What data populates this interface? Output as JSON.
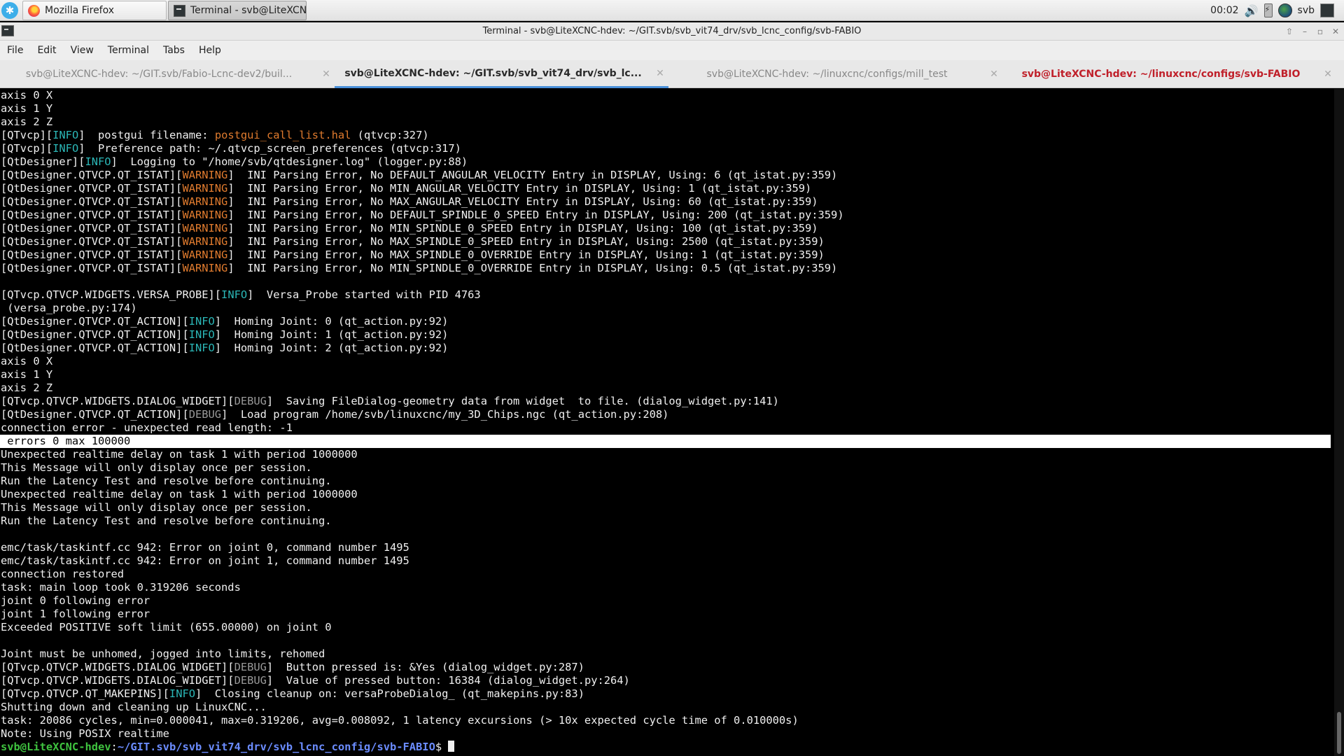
{
  "taskbar": {
    "menu_icon": "start-menu-icon",
    "windows": [
      {
        "label": "Mozilla Firefox",
        "icon": "firefox-icon"
      },
      {
        "label": "Terminal - svb@LiteXCN...",
        "icon": "terminal-icon"
      }
    ],
    "clock": "00:02",
    "user": "svb"
  },
  "window": {
    "title": "Terminal - svb@LiteXCNC-hdev: ~/GIT.svb/svb_vit74_drv/svb_lcnc_config/svb-FABIO"
  },
  "menu": [
    "File",
    "Edit",
    "View",
    "Terminal",
    "Tabs",
    "Help"
  ],
  "tabs": [
    {
      "label": "svb@LiteXCNC-hdev: ~/GIT.svb/Fabio-Lcnc-dev2/buil...",
      "state": "inactive"
    },
    {
      "label": "svb@LiteXCNC-hdev: ~/GIT.svb/svb_vit74_drv/svb_lc...",
      "state": "active"
    },
    {
      "label": "svb@LiteXCNC-hdev: ~/linuxcnc/configs/mill_test",
      "state": "inactive"
    },
    {
      "label": "svb@LiteXCNC-hdev: ~/linuxcnc/configs/svb-FABIO",
      "state": "alert"
    }
  ],
  "colors": {
    "info": "#2bb7b7",
    "warning": "#e07b2e",
    "debug": "#999999",
    "prompt_user": "#3fc23f",
    "prompt_path": "#6b8cff",
    "active_tab_underline": "#4a90d9",
    "alert_tab": "#c0202a"
  },
  "terminal": {
    "lines": [
      [
        {
          "t": "axis 0 X"
        }
      ],
      [
        {
          "t": "axis 1 Y"
        }
      ],
      [
        {
          "t": "axis 2 Z"
        }
      ],
      [
        {
          "t": "[QTvcp]["
        },
        {
          "t": "INFO",
          "c": "info"
        },
        {
          "t": "]  postgui filename: "
        },
        {
          "t": "postgui_call_list.hal",
          "c": "file"
        },
        {
          "t": " (qtvcp:327)"
        }
      ],
      [
        {
          "t": "[QTvcp]["
        },
        {
          "t": "INFO",
          "c": "info"
        },
        {
          "t": "]  Preference path: ~/.qtvcp_screen_preferences (qtvcp:317)"
        }
      ],
      [
        {
          "t": "[QtDesigner]["
        },
        {
          "t": "INFO",
          "c": "info"
        },
        {
          "t": "]  Logging to \"/home/svb/qtdesigner.log\" (logger.py:88)"
        }
      ],
      [
        {
          "t": "[QtDesigner.QTVCP.QT_ISTAT]["
        },
        {
          "t": "WARNING",
          "c": "warn"
        },
        {
          "t": "]  INI Parsing Error, No DEFAULT_ANGULAR_VELOCITY Entry in DISPLAY, Using: 6 (qt_istat.py:359)"
        }
      ],
      [
        {
          "t": "[QtDesigner.QTVCP.QT_ISTAT]["
        },
        {
          "t": "WARNING",
          "c": "warn"
        },
        {
          "t": "]  INI Parsing Error, No MIN_ANGULAR_VELOCITY Entry in DISPLAY, Using: 1 (qt_istat.py:359)"
        }
      ],
      [
        {
          "t": "[QtDesigner.QTVCP.QT_ISTAT]["
        },
        {
          "t": "WARNING",
          "c": "warn"
        },
        {
          "t": "]  INI Parsing Error, No MAX_ANGULAR_VELOCITY Entry in DISPLAY, Using: 60 (qt_istat.py:359)"
        }
      ],
      [
        {
          "t": "[QtDesigner.QTVCP.QT_ISTAT]["
        },
        {
          "t": "WARNING",
          "c": "warn"
        },
        {
          "t": "]  INI Parsing Error, No DEFAULT_SPINDLE_0_SPEED Entry in DISPLAY, Using: 200 (qt_istat.py:359)"
        }
      ],
      [
        {
          "t": "[QtDesigner.QTVCP.QT_ISTAT]["
        },
        {
          "t": "WARNING",
          "c": "warn"
        },
        {
          "t": "]  INI Parsing Error, No MIN_SPINDLE_0_SPEED Entry in DISPLAY, Using: 100 (qt_istat.py:359)"
        }
      ],
      [
        {
          "t": "[QtDesigner.QTVCP.QT_ISTAT]["
        },
        {
          "t": "WARNING",
          "c": "warn"
        },
        {
          "t": "]  INI Parsing Error, No MAX_SPINDLE_0_SPEED Entry in DISPLAY, Using: 2500 (qt_istat.py:359)"
        }
      ],
      [
        {
          "t": "[QtDesigner.QTVCP.QT_ISTAT]["
        },
        {
          "t": "WARNING",
          "c": "warn"
        },
        {
          "t": "]  INI Parsing Error, No MAX_SPINDLE_0_OVERRIDE Entry in DISPLAY, Using: 1 (qt_istat.py:359)"
        }
      ],
      [
        {
          "t": "[QtDesigner.QTVCP.QT_ISTAT]["
        },
        {
          "t": "WARNING",
          "c": "warn"
        },
        {
          "t": "]  INI Parsing Error, No MIN_SPINDLE_0_OVERRIDE Entry in DISPLAY, Using: 0.5 (qt_istat.py:359)"
        }
      ],
      [
        {
          "t": ""
        }
      ],
      [
        {
          "t": "[QTvcp.QTVCP.WIDGETS.VERSA_PROBE]["
        },
        {
          "t": "INFO",
          "c": "info"
        },
        {
          "t": "]  Versa_Probe started with PID 4763"
        }
      ],
      [
        {
          "t": " (versa_probe.py:174)"
        }
      ],
      [
        {
          "t": "[QtDesigner.QTVCP.QT_ACTION]["
        },
        {
          "t": "INFO",
          "c": "info"
        },
        {
          "t": "]  Homing Joint: 0 (qt_action.py:92)"
        }
      ],
      [
        {
          "t": "[QtDesigner.QTVCP.QT_ACTION]["
        },
        {
          "t": "INFO",
          "c": "info"
        },
        {
          "t": "]  Homing Joint: 1 (qt_action.py:92)"
        }
      ],
      [
        {
          "t": "[QtDesigner.QTVCP.QT_ACTION]["
        },
        {
          "t": "INFO",
          "c": "info"
        },
        {
          "t": "]  Homing Joint: 2 (qt_action.py:92)"
        }
      ],
      [
        {
          "t": "axis 0 X"
        }
      ],
      [
        {
          "t": "axis 1 Y"
        }
      ],
      [
        {
          "t": "axis 2 Z"
        }
      ],
      [
        {
          "t": "[QTvcp.QTVCP.WIDGETS.DIALOG_WIDGET]["
        },
        {
          "t": "DEBUG",
          "c": "debug"
        },
        {
          "t": "]  Saving FileDialog-geometry data from widget  to file. (dialog_widget.py:141)"
        }
      ],
      [
        {
          "t": "[QtDesigner.QTVCP.QT_ACTION]["
        },
        {
          "t": "DEBUG",
          "c": "debug"
        },
        {
          "t": "]  Load program /home/svb/linuxcnc/my_3D_Chips.ngc (qt_action.py:208)"
        }
      ],
      [
        {
          "t": "connection error - unexpected read length: -1"
        }
      ],
      [
        {
          "t": " errors 0 max 100000",
          "hl": true
        }
      ],
      [
        {
          "t": "Unexpected realtime delay on task 1 with period 1000000"
        }
      ],
      [
        {
          "t": "This Message will only display once per session."
        }
      ],
      [
        {
          "t": "Run the Latency Test and resolve before continuing."
        }
      ],
      [
        {
          "t": "Unexpected realtime delay on task 1 with period 1000000"
        }
      ],
      [
        {
          "t": "This Message will only display once per session."
        }
      ],
      [
        {
          "t": "Run the Latency Test and resolve before continuing."
        }
      ],
      [
        {
          "t": ""
        }
      ],
      [
        {
          "t": "emc/task/taskintf.cc 942: Error on joint 0, command number 1495"
        }
      ],
      [
        {
          "t": "emc/task/taskintf.cc 942: Error on joint 1, command number 1495"
        }
      ],
      [
        {
          "t": "connection restored"
        }
      ],
      [
        {
          "t": "task: main loop took 0.319206 seconds"
        }
      ],
      [
        {
          "t": "joint 0 following error"
        }
      ],
      [
        {
          "t": "joint 1 following error"
        }
      ],
      [
        {
          "t": "Exceeded POSITIVE soft limit (655.00000) on joint 0"
        }
      ],
      [
        {
          "t": ""
        }
      ],
      [
        {
          "t": "Joint must be unhomed, jogged into limits, rehomed"
        }
      ],
      [
        {
          "t": "[QTvcp.QTVCP.WIDGETS.DIALOG_WIDGET]["
        },
        {
          "t": "DEBUG",
          "c": "debug"
        },
        {
          "t": "]  Button pressed is: &Yes (dialog_widget.py:287)"
        }
      ],
      [
        {
          "t": "[QTvcp.QTVCP.WIDGETS.DIALOG_WIDGET]["
        },
        {
          "t": "DEBUG",
          "c": "debug"
        },
        {
          "t": "]  Value of pressed button: 16384 (dialog_widget.py:264)"
        }
      ],
      [
        {
          "t": "[QTvcp.QTVCP.QT_MAKEPINS]["
        },
        {
          "t": "INFO",
          "c": "info"
        },
        {
          "t": "]  Closing cleanup on: versaProbeDialog_ (qt_makepins.py:83)"
        }
      ],
      [
        {
          "t": "Shutting down and cleaning up LinuxCNC..."
        }
      ],
      [
        {
          "t": "task: 20086 cycles, min=0.000041, max=0.319206, avg=0.008092, 1 latency excursions (> 10x expected cycle time of 0.010000s)"
        }
      ],
      [
        {
          "t": "Note: Using POSIX realtime"
        }
      ]
    ],
    "prompt": {
      "user_host": "svb@LiteXCNC-hdev",
      "sep": ":",
      "path": "~/GIT.svb/svb_vit74_drv/svb_lcnc_config/svb-FABIO",
      "symbol": "$ "
    }
  }
}
